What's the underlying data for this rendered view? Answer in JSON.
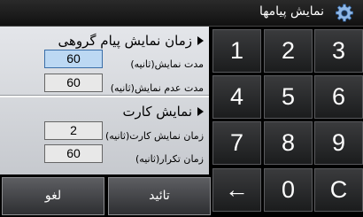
{
  "titlebar": {
    "title": "نمایش پیامها",
    "settings_icon": "gear-icon"
  },
  "section_group": {
    "header": "زمان نمایش پیام گروهی",
    "show_label": "مدت نمایش(ثانیه)",
    "show_value": "60",
    "hide_label": "مدت عدم نمایش(ثانیه)",
    "hide_value": "60"
  },
  "section_card": {
    "header": "نمایش کارت",
    "show_label": "زمان نمایش کارت(ثانیه)",
    "show_value": "2",
    "repeat_label": "زمان تکرار(ثانیه)",
    "repeat_value": "60"
  },
  "keypad": {
    "k1": "1",
    "k2": "2",
    "k3": "3",
    "k4": "4",
    "k5": "5",
    "k6": "6",
    "k7": "7",
    "k8": "8",
    "k9": "9",
    "back": "←",
    "k0": "0",
    "clear": "C"
  },
  "buttons": {
    "cancel": "لغو",
    "confirm": "تائید"
  }
}
